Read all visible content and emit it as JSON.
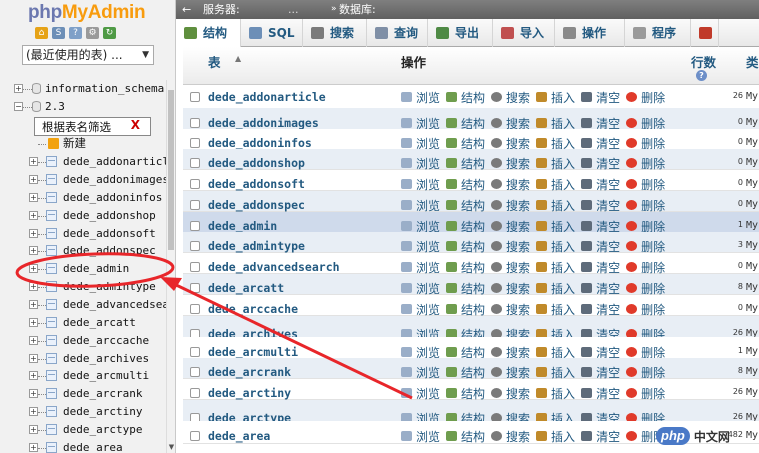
{
  "nav": {
    "logo_part1": "php",
    "logo_part2": "MyAdmin",
    "recent_label": "(最近使用的表) ...",
    "icons": [
      "home-icon",
      "sql-query-icon",
      "docs-icon",
      "settings-icon",
      "reload-icon"
    ],
    "tree": [
      {
        "type": "db",
        "label": "information_schema"
      },
      {
        "type": "db",
        "label": "2.3"
      },
      {
        "type": "new",
        "label": "新建"
      },
      {
        "type": "table",
        "label": "dede_addonarticle"
      },
      {
        "type": "table",
        "label": "dede_addonimages"
      },
      {
        "type": "table",
        "label": "dede_addoninfos"
      },
      {
        "type": "table",
        "label": "dede_addonshop"
      },
      {
        "type": "table",
        "label": "dede_addonsoft"
      },
      {
        "type": "table",
        "label": "dede_addonspec"
      },
      {
        "type": "table",
        "label": "dede_admin"
      },
      {
        "type": "table",
        "label": "dede_admintype"
      },
      {
        "type": "table",
        "label": "dede_advancedsear"
      },
      {
        "type": "table",
        "label": "dede_arcatt"
      },
      {
        "type": "table",
        "label": "dede_arccache"
      },
      {
        "type": "table",
        "label": "dede_archives"
      },
      {
        "type": "table",
        "label": "dede_arcmulti"
      },
      {
        "type": "table",
        "label": "dede_arcrank"
      },
      {
        "type": "table",
        "label": "dede_arctiny"
      },
      {
        "type": "table",
        "label": "dede_arctype"
      },
      {
        "type": "table",
        "label": "dede_area"
      }
    ],
    "filter_label": "根据表名筛选",
    "filter_clear": "X"
  },
  "topbar": {
    "back": "←",
    "server_label": "服务器:",
    "server_value": "...",
    "sep": "»",
    "db_label": "数据库:"
  },
  "tabs": [
    {
      "label": "结构",
      "icon": "structure-icon",
      "color": "#5f8f3e"
    },
    {
      "label": "SQL",
      "icon": "sql-icon",
      "color": "#6d8fb7"
    },
    {
      "label": "搜索",
      "icon": "search-icon",
      "color": "#7a7a7a"
    },
    {
      "label": "查询",
      "icon": "query-icon",
      "color": "#7f8fa6"
    },
    {
      "label": "导出",
      "icon": "export-icon",
      "color": "#4f8a45"
    },
    {
      "label": "导入",
      "icon": "import-icon",
      "color": "#c05050"
    },
    {
      "label": "操作",
      "icon": "operations-icon",
      "color": "#8a8a8a"
    },
    {
      "label": "程序",
      "icon": "routines-icon",
      "color": "#9a9a9a"
    },
    {
      "label": "",
      "icon": "events-icon",
      "color": "#c03a2a"
    }
  ],
  "table_header": {
    "table": "表",
    "sort": "▲",
    "action": "操作",
    "rows": "行数",
    "rows_help": "?",
    "type": "类"
  },
  "actions": {
    "browse": "浏览",
    "structure": "结构",
    "search": "搜索",
    "insert": "插入",
    "empty": "清空",
    "drop": "删除"
  },
  "table_rows": [
    {
      "name": "dede_addonarticle",
      "rows": "26",
      "type": "My"
    },
    {
      "name": "dede_addonimages",
      "rows": "0",
      "type": "My"
    },
    {
      "name": "dede_addoninfos",
      "rows": "0",
      "type": "My"
    },
    {
      "name": "dede_addonshop",
      "rows": "0",
      "type": "My"
    },
    {
      "name": "dede_addonsoft",
      "rows": "0",
      "type": "My"
    },
    {
      "name": "dede_addonspec",
      "rows": "0",
      "type": "My"
    },
    {
      "name": "dede_admin",
      "rows": "1",
      "type": "My"
    },
    {
      "name": "dede_admintype",
      "rows": "3",
      "type": "My"
    },
    {
      "name": "dede_advancedsearch",
      "rows": "0",
      "type": "My"
    },
    {
      "name": "dede_arcatt",
      "rows": "8",
      "type": "My"
    },
    {
      "name": "dede_arccache",
      "rows": "0",
      "type": "My"
    },
    {
      "name": "dede_archives",
      "rows": "26",
      "type": "My"
    },
    {
      "name": "dede_arcmulti",
      "rows": "1",
      "type": "My"
    },
    {
      "name": "dede_arcrank",
      "rows": "8",
      "type": "My"
    },
    {
      "name": "dede_arctiny",
      "rows": "26",
      "type": "My"
    },
    {
      "name": "dede_arctype",
      "rows": "26",
      "type": "My"
    },
    {
      "name": "dede_area",
      "rows": "482",
      "type": "My"
    }
  ],
  "watermark": {
    "badge": "php",
    "text": "中文网"
  },
  "colors": {
    "annotation": "#e8262a",
    "highlight_row": "#cfdaeb",
    "link": "#235a81"
  }
}
